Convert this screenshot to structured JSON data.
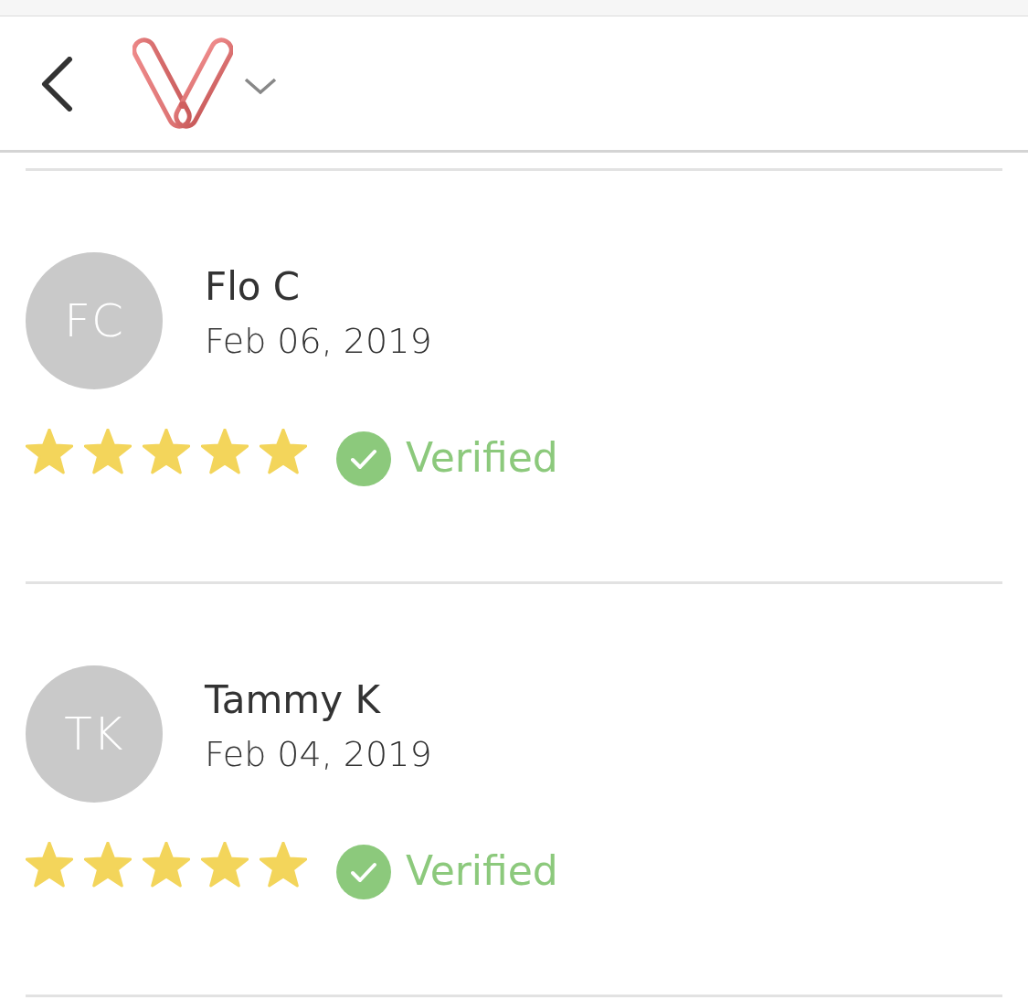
{
  "reviews": [
    {
      "initials": "FC",
      "name": "Flo C",
      "date": "Feb 06, 2019",
      "stars": 5,
      "verified": true,
      "badge": "Verified"
    },
    {
      "initials": "TK",
      "name": "Tammy K",
      "date": "Feb 04, 2019",
      "stars": 5,
      "verified": true,
      "badge": "Verified"
    }
  ]
}
